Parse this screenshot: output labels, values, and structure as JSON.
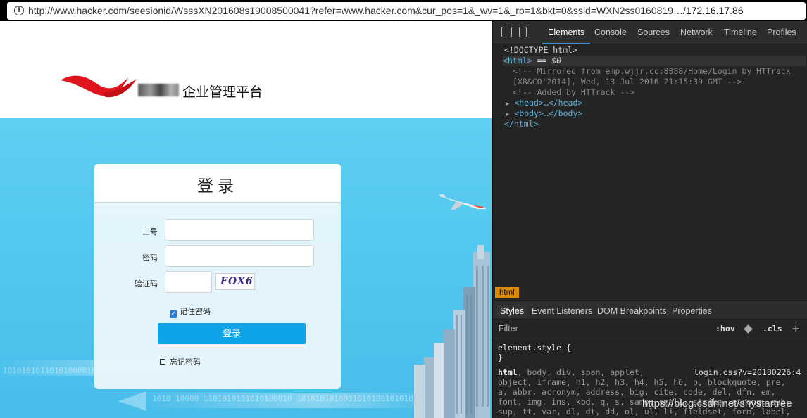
{
  "address_bar": {
    "url": "http://www.hacker.com/seesionid/WsssXN201608s19008500041?refer=www.hacker.com&cur_pos=1&_wv=1&_rp=1&bkt=0&ssid=WXN2ss0160819…/",
    "ip_suffix": "172.16.17.86"
  },
  "page": {
    "brand_text": "企业管理平台",
    "binary_row_1": "1010101011010100001010101010000101010",
    "binary_row_2": "1010 10000 1101010101010100010 10101010100010101001010101010110",
    "login": {
      "title": "登录",
      "employee_id_label": "工号",
      "employee_id_value": "",
      "password_label": "密码",
      "password_value": "",
      "captcha_label": "验证码",
      "captcha_value": "",
      "captcha_image_text": "FOX6",
      "remember_label": "记住密码",
      "remember_checked": true,
      "submit_label": "登录",
      "forgot_label": "忘记密码"
    }
  },
  "devtools": {
    "tabs": [
      "Elements",
      "Console",
      "Sources",
      "Network",
      "Timeline",
      "Profiles"
    ],
    "active_tab": "Elements",
    "dom_lines": {
      "doctype": "<!DOCTYPE html>",
      "html_open": "<html>",
      "html_selected_marker": "== $0",
      "comment_1": "<!-- Mirrored from emp.wjjr.cc:8888/Home/Login by HTTrack",
      "comment_2": "[XR&CO'2014], Wed, 13 Jul 2016 21:15:39 GMT -->",
      "comment_3": "<!-- Added by HTTrack -->",
      "head": "<head>…</head>",
      "body": "<body>…</body>",
      "html_close": "</html>"
    },
    "breadcrumb": "html",
    "subtabs": [
      "Styles",
      "Event Listeners",
      "DOM Breakpoints",
      "Properties"
    ],
    "active_subtab": "Styles",
    "filter_label": "Filter",
    "hov_label": ":hov",
    "cls_label": ".cls",
    "styles": {
      "element_style_open": "element.style {",
      "element_style_close": "}",
      "selector_head": "html",
      "selector_rest_1": ", body, div, span, applet,",
      "source_link": "login.css?v=20180226:4",
      "selector_rest_2": "object, iframe, h1, h2, h3, h4, h5, h6, p, blockquote, pre,",
      "selector_rest_3": "a, abbr, acronym, address, big, cite, code, del, dfn, em,",
      "selector_rest_4": "font, img, ins, kbd, q, s, samp, small, strike, strong, sub,",
      "selector_rest_5": "sup, tt, var, dl, dt, dd, ol, ul, li, fieldset, form, label,"
    }
  },
  "watermark": "https://blog.csdn.net/shystartree",
  "colors": {
    "banner": "#52c7f0",
    "login_button": "#0fa3e8",
    "devtools_bg": "#242424",
    "devtools_tag": "#5db0d7",
    "breadcrumb_bg": "#d88b08",
    "logo_red": "#e0141c"
  }
}
